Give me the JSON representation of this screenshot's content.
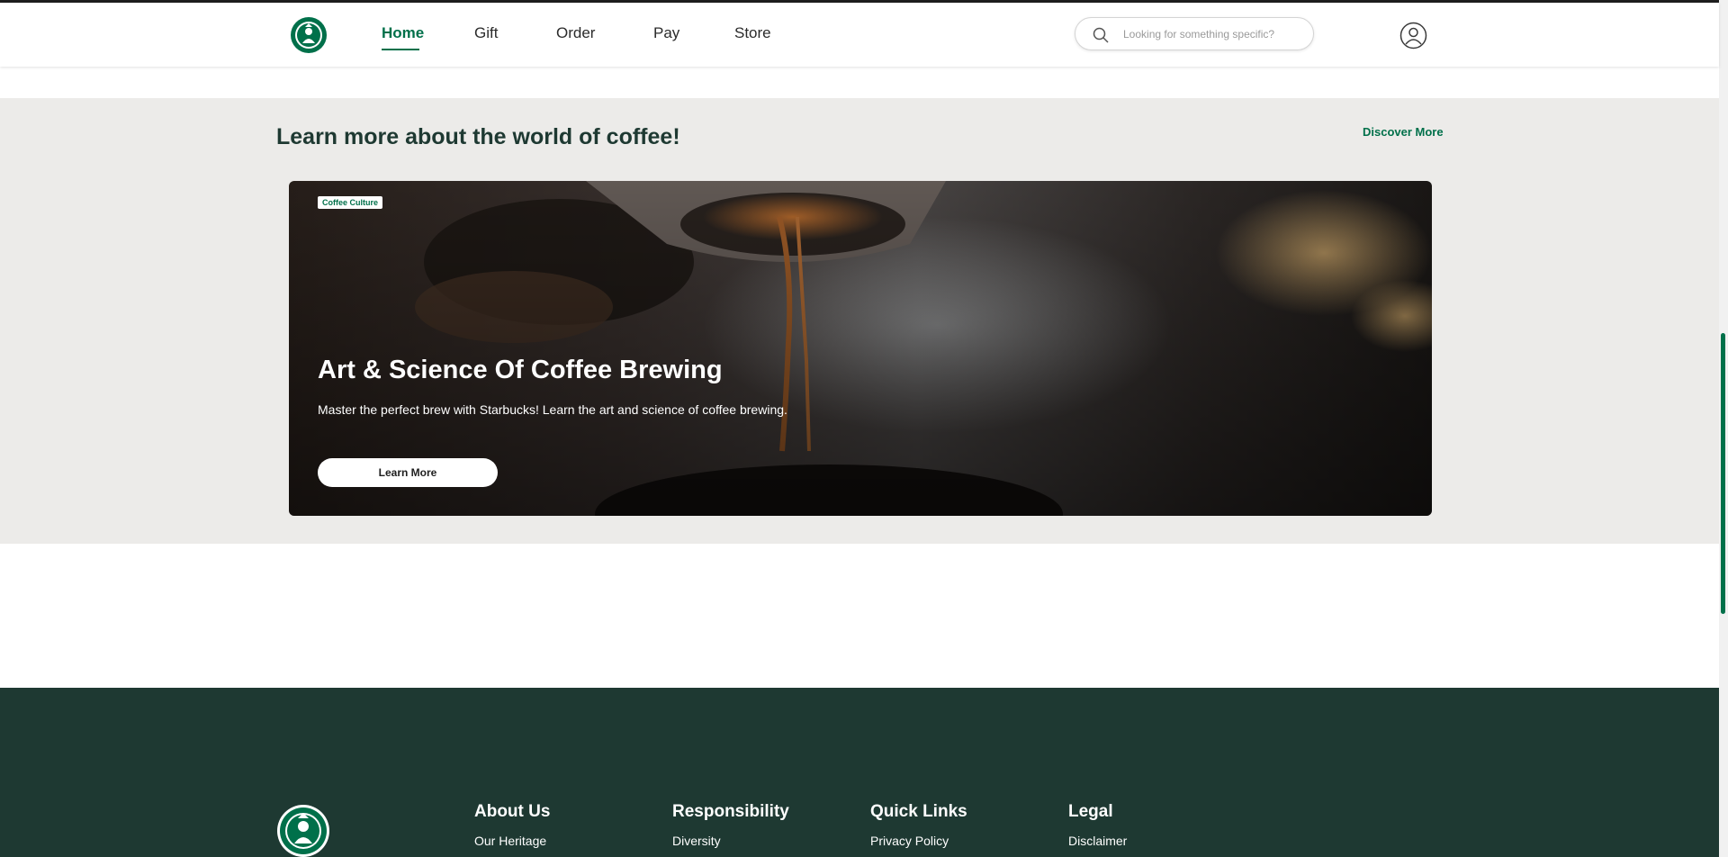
{
  "header": {
    "nav": [
      {
        "label": "Home",
        "active": true
      },
      {
        "label": "Gift",
        "active": false
      },
      {
        "label": "Order",
        "active": false
      },
      {
        "label": "Pay",
        "active": false
      },
      {
        "label": "Store",
        "active": false
      }
    ],
    "search": {
      "placeholder": "Looking for something specific?",
      "value": ""
    },
    "icons": {
      "logo": "starbucks-siren-logo",
      "search": "search-icon",
      "account": "user-circle-icon"
    }
  },
  "coffee_section": {
    "title": "Learn more about the world of coffee!",
    "discover_link": "Discover More",
    "card": {
      "tag": "Coffee Culture",
      "title": "Art & Science Of Coffee Brewing",
      "description": "Master the perfect brew with Starbucks! Learn the art and science of coffee brewing.",
      "button": "Learn More"
    }
  },
  "footer": {
    "columns": [
      {
        "heading": "About Us",
        "links": [
          "Our Heritage"
        ]
      },
      {
        "heading": "Responsibility",
        "links": [
          "Diversity"
        ]
      },
      {
        "heading": "Quick Links",
        "links": [
          "Privacy Policy"
        ]
      },
      {
        "heading": "Legal",
        "links": [
          "Disclaimer"
        ]
      }
    ]
  },
  "colors": {
    "brand_green": "#00704a",
    "house_green": "#1e3932",
    "section_bg": "#ecebe9",
    "white": "#ffffff"
  }
}
